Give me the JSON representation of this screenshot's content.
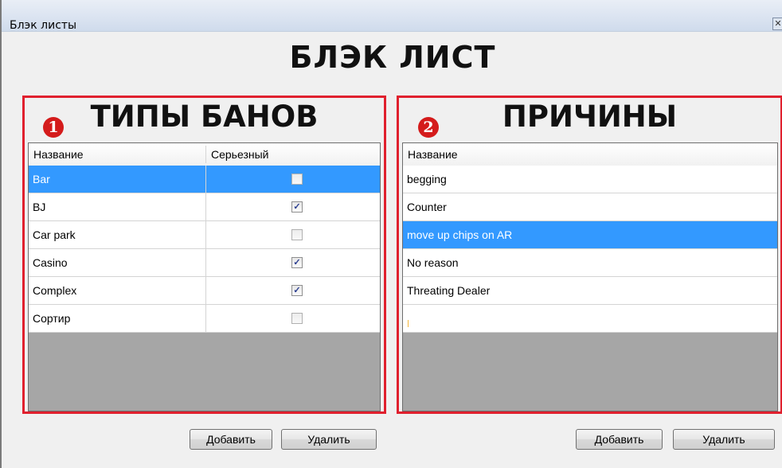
{
  "window": {
    "title": "Блэк листы",
    "close_glyph": "✕"
  },
  "main_title": "БЛЭК ЛИСТ",
  "ban_types": {
    "badge": "1",
    "title": "ТИПЫ БАНОВ",
    "columns": [
      "Название",
      "Серьезный"
    ],
    "rows": [
      {
        "name": "Bar",
        "serious": false,
        "selected": true
      },
      {
        "name": "BJ",
        "serious": true,
        "selected": false
      },
      {
        "name": "Car park",
        "serious": false,
        "selected": false
      },
      {
        "name": "Casino",
        "serious": true,
        "selected": false
      },
      {
        "name": "Complex",
        "serious": true,
        "selected": false
      },
      {
        "name": "Сортир",
        "serious": false,
        "selected": false
      }
    ],
    "add_label": "Добавить",
    "delete_label": "Удалить"
  },
  "reasons": {
    "badge": "2",
    "title": "ПРИЧИНЫ",
    "columns": [
      "Название"
    ],
    "rows": [
      {
        "name": "begging",
        "selected": false
      },
      {
        "name": "Counter",
        "selected": false
      },
      {
        "name": "move up chips on AR",
        "selected": true
      },
      {
        "name": "No reason",
        "selected": false
      },
      {
        "name": "Threating Dealer",
        "selected": false
      },
      {
        "name": "",
        "selected": false,
        "editing": true
      }
    ],
    "add_label": "Добавить",
    "delete_label": "Удалить"
  },
  "colors": {
    "highlight_border": "#e0202e",
    "selection": "#3399ff",
    "badge": "#d41b1b",
    "grid_empty": "#a6a6a6"
  },
  "icons": {
    "close": "close-icon",
    "check": "checkmark-icon"
  }
}
